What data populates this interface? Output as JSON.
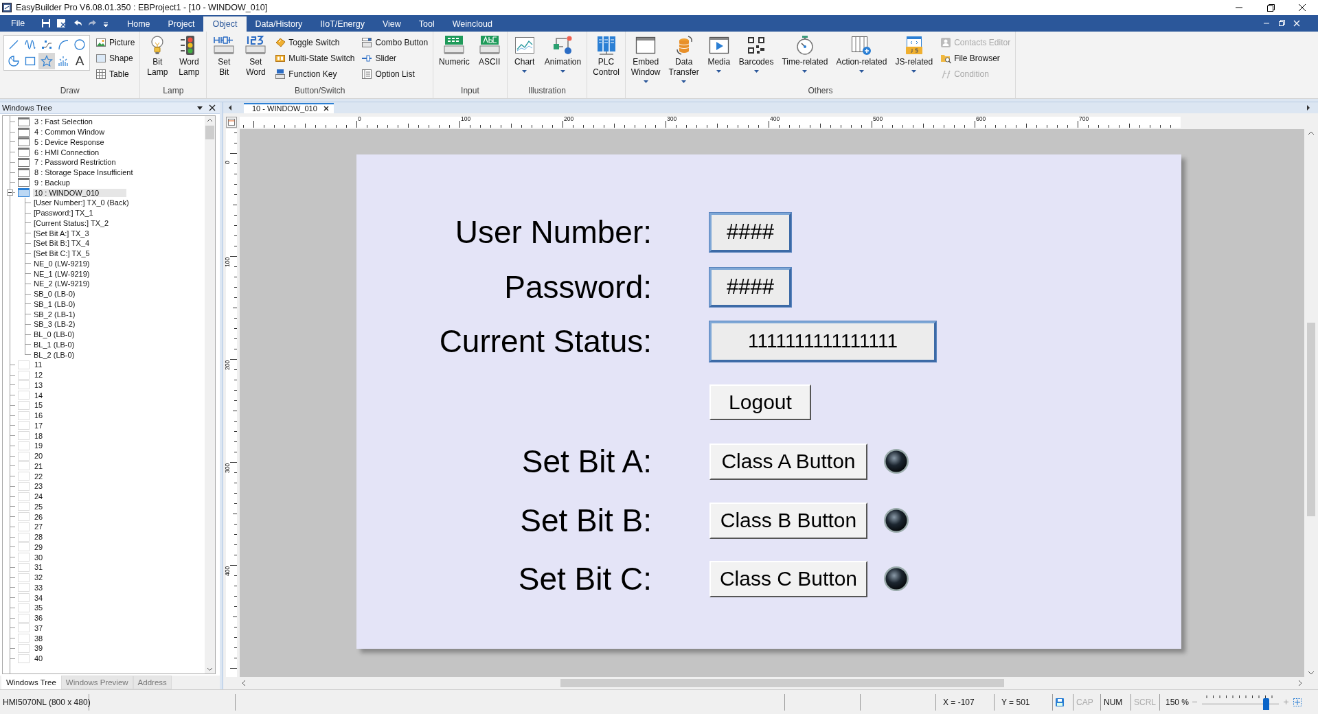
{
  "window": {
    "title": "EasyBuilder Pro V6.08.01.350 : EBProject1 - [10 - WINDOW_010]"
  },
  "menu": {
    "file": "File",
    "tabs": [
      {
        "label": "Home",
        "selected": false
      },
      {
        "label": "Project",
        "selected": false
      },
      {
        "label": "Object",
        "selected": true
      },
      {
        "label": "Data/History",
        "selected": false
      },
      {
        "label": "IIoT/Energy",
        "selected": false
      },
      {
        "label": "View",
        "selected": false
      },
      {
        "label": "Tool",
        "selected": false
      },
      {
        "label": "Weincloud",
        "selected": false
      }
    ]
  },
  "ribbon": {
    "groups": [
      {
        "label": "Draw",
        "tools": [
          {
            "selected": false
          },
          {
            "selected": false
          },
          {
            "selected": false
          },
          {
            "selected": false
          },
          {
            "selected": false
          },
          {
            "selected": false
          },
          {
            "selected": false
          },
          {
            "selected": true
          },
          {
            "selected": false
          },
          {
            "selected": false,
            "glyph": "A"
          }
        ],
        "items": [
          {
            "label": "Picture",
            "kind": "small",
            "disabled": false
          },
          {
            "label": "Shape",
            "kind": "small",
            "disabled": false
          },
          {
            "label": "Table",
            "kind": "small",
            "disabled": false
          }
        ]
      },
      {
        "label": "Lamp",
        "items": [
          {
            "label": "Bit Lamp",
            "kind": "big",
            "menu": false,
            "disabled": false
          },
          {
            "label": "Word Lamp",
            "kind": "big",
            "menu": false,
            "disabled": false
          }
        ]
      },
      {
        "label": "Button/Switch",
        "items": [
          {
            "label": "Set Bit",
            "kind": "big",
            "menu": false,
            "disabled": false
          },
          {
            "label": "Set Word",
            "kind": "big",
            "menu": false,
            "disabled": false
          },
          {
            "label": "Toggle Switch",
            "kind": "small",
            "disabled": false
          },
          {
            "label": "Multi-State Switch",
            "kind": "small",
            "disabled": false
          },
          {
            "label": "Function Key",
            "kind": "small",
            "disabled": false
          },
          {
            "label": "Combo Button",
            "kind": "small",
            "disabled": false
          },
          {
            "label": "Slider",
            "kind": "small",
            "disabled": false
          },
          {
            "label": "Option List",
            "kind": "small",
            "disabled": false
          }
        ]
      },
      {
        "label": "Input",
        "items": [
          {
            "label": "Numeric",
            "kind": "big",
            "menu": false,
            "disabled": false
          },
          {
            "label": "ASCII",
            "kind": "big",
            "menu": false,
            "disabled": false
          }
        ]
      },
      {
        "label": "Illustration",
        "items": [
          {
            "label": "Chart",
            "kind": "big",
            "menu": true,
            "disabled": false
          },
          {
            "label": "Animation",
            "kind": "big",
            "menu": true,
            "disabled": false
          }
        ]
      },
      {
        "items": [
          {
            "label": "PLC Control",
            "kind": "big",
            "menu": false,
            "disabled": false
          }
        ]
      },
      {
        "label": "Others",
        "items": [
          {
            "label": "Embed Window",
            "kind": "big",
            "menu": true,
            "disabled": false
          },
          {
            "label": "Data Transfer",
            "kind": "big",
            "menu": true,
            "disabled": false
          },
          {
            "label": "Media",
            "kind": "big",
            "menu": true,
            "disabled": false
          },
          {
            "label": "Barcodes",
            "kind": "big",
            "menu": true,
            "disabled": false
          },
          {
            "label": "Time-related",
            "kind": "big",
            "menu": true,
            "disabled": false
          },
          {
            "label": "Action-related",
            "kind": "big",
            "menu": true,
            "disabled": false
          },
          {
            "label": "JS-related",
            "kind": "big",
            "menu": true,
            "disabled": false
          },
          {
            "label": "Contacts Editor",
            "kind": "small",
            "disabled": true
          },
          {
            "label": "File Browser",
            "kind": "small",
            "disabled": false
          },
          {
            "label": "Condition",
            "kind": "small",
            "disabled": true
          }
        ]
      }
    ]
  },
  "panel": {
    "title": "Windows Tree",
    "tree": [
      {
        "label": "3 : Fast Selection",
        "kind": "window",
        "selected": false,
        "expanded": false
      },
      {
        "label": "4 : Common Window",
        "kind": "window",
        "selected": false,
        "expanded": false
      },
      {
        "label": "5 : Device Response",
        "kind": "window",
        "selected": false,
        "expanded": false
      },
      {
        "label": "6 : HMI Connection",
        "kind": "window",
        "selected": false,
        "expanded": false
      },
      {
        "label": "7 : Password Restriction",
        "kind": "window",
        "selected": false,
        "expanded": false
      },
      {
        "label": "8 : Storage Space Insufficient",
        "kind": "window",
        "selected": false,
        "expanded": false
      },
      {
        "label": "9 : Backup",
        "kind": "window",
        "selected": false,
        "expanded": false
      },
      {
        "label": "10 : WINDOW_010",
        "kind": "window",
        "selected": true,
        "expanded": true,
        "children": [
          {
            "label": "[User Number:] TX_0 (Back)"
          },
          {
            "label": "[Password:] TX_1"
          },
          {
            "label": "[Current Status:] TX_2"
          },
          {
            "label": "[Set Bit A:] TX_3"
          },
          {
            "label": "[Set Bit B:] TX_4"
          },
          {
            "label": "[Set Bit C:] TX_5"
          },
          {
            "label": "NE_0 (LW-9219)"
          },
          {
            "label": "NE_1 (LW-9219)"
          },
          {
            "label": "NE_2 (LW-9219)"
          },
          {
            "label": "SB_0 (LB-0)"
          },
          {
            "label": "SB_1 (LB-0)"
          },
          {
            "label": "SB_2 (LB-1)"
          },
          {
            "label": "SB_3 (LB-2)"
          },
          {
            "label": "BL_0 (LB-0)"
          },
          {
            "label": "BL_1 (LB-0)"
          },
          {
            "label": "BL_2 (LB-0)"
          }
        ]
      },
      {
        "label": "11",
        "kind": "empty",
        "selected": false,
        "expanded": false
      },
      {
        "label": "12",
        "kind": "empty",
        "selected": false,
        "expanded": false
      },
      {
        "label": "13",
        "kind": "empty",
        "selected": false,
        "expanded": false
      },
      {
        "label": "14",
        "kind": "empty",
        "selected": false,
        "expanded": false
      },
      {
        "label": "15",
        "kind": "empty",
        "selected": false,
        "expanded": false
      },
      {
        "label": "16",
        "kind": "empty",
        "selected": false,
        "expanded": false
      },
      {
        "label": "17",
        "kind": "empty",
        "selected": false,
        "expanded": false
      },
      {
        "label": "18",
        "kind": "empty",
        "selected": false,
        "expanded": false
      },
      {
        "label": "19",
        "kind": "empty",
        "selected": false,
        "expanded": false
      },
      {
        "label": "20",
        "kind": "empty",
        "selected": false,
        "expanded": false
      },
      {
        "label": "21",
        "kind": "empty",
        "selected": false,
        "expanded": false
      },
      {
        "label": "22",
        "kind": "empty",
        "selected": false,
        "expanded": false
      },
      {
        "label": "23",
        "kind": "empty",
        "selected": false,
        "expanded": false
      },
      {
        "label": "24",
        "kind": "empty",
        "selected": false,
        "expanded": false
      },
      {
        "label": "25",
        "kind": "empty",
        "selected": false,
        "expanded": false
      },
      {
        "label": "26",
        "kind": "empty",
        "selected": false,
        "expanded": false
      },
      {
        "label": "27",
        "kind": "empty",
        "selected": false,
        "expanded": false
      },
      {
        "label": "28",
        "kind": "empty",
        "selected": false,
        "expanded": false
      },
      {
        "label": "29",
        "kind": "empty",
        "selected": false,
        "expanded": false
      },
      {
        "label": "30",
        "kind": "empty",
        "selected": false,
        "expanded": false
      },
      {
        "label": "31",
        "kind": "empty",
        "selected": false,
        "expanded": false
      },
      {
        "label": "32",
        "kind": "empty",
        "selected": false,
        "expanded": false
      },
      {
        "label": "33",
        "kind": "empty",
        "selected": false,
        "expanded": false
      },
      {
        "label": "34",
        "kind": "empty",
        "selected": false,
        "expanded": false
      },
      {
        "label": "35",
        "kind": "empty",
        "selected": false,
        "expanded": false
      },
      {
        "label": "36",
        "kind": "empty",
        "selected": false,
        "expanded": false
      },
      {
        "label": "37",
        "kind": "empty",
        "selected": false,
        "expanded": false
      },
      {
        "label": "38",
        "kind": "empty",
        "selected": false,
        "expanded": false
      },
      {
        "label": "39",
        "kind": "empty",
        "selected": false,
        "expanded": false
      },
      {
        "label": "40",
        "kind": "empty",
        "selected": false,
        "expanded": false
      }
    ],
    "tabs": [
      {
        "label": "Windows Tree",
        "selected": true
      },
      {
        "label": "Windows Preview",
        "selected": false
      },
      {
        "label": "Address",
        "selected": false
      }
    ]
  },
  "editor": {
    "tabs": [
      {
        "label": "10 - WINDOW_010",
        "selected": true
      }
    ],
    "rulers": {
      "horizontal": [
        "0",
        "100",
        "200",
        "300",
        "400",
        "500",
        "600",
        "700"
      ],
      "vertical": [
        "0",
        "100",
        "200",
        "300",
        "400"
      ]
    },
    "rows": [
      {
        "kind": "numeric",
        "label": "User Number:",
        "value": "####"
      },
      {
        "kind": "numeric",
        "label": "Password:",
        "value": "####"
      },
      {
        "kind": "status",
        "label": "Current Status:",
        "value": "1111111111111111"
      },
      {
        "kind": "button",
        "button": "Logout"
      },
      {
        "kind": "bit",
        "label": "Set Bit A:",
        "button": "Class A Button",
        "lamp_on": false
      },
      {
        "kind": "bit",
        "label": "Set Bit B:",
        "button": "Class B Button",
        "lamp_on": false
      },
      {
        "kind": "bit",
        "label": "Set Bit C:",
        "button": "Class C Button",
        "lamp_on": false
      }
    ]
  },
  "status_bar": {
    "model": "HMI5070NL (800 x 480)",
    "x": "X = -107",
    "y": "Y = 501",
    "keys": [
      {
        "label": "CAP",
        "on": false
      },
      {
        "label": "NUM",
        "on": true
      },
      {
        "label": "SCRL",
        "on": false
      }
    ],
    "zoom": {
      "reading": "150 %",
      "level": 0.79
    }
  }
}
